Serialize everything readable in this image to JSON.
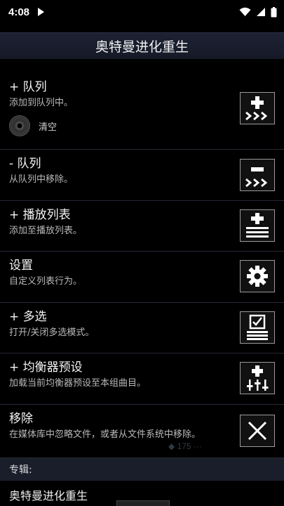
{
  "status": {
    "time": "4:08"
  },
  "header": {
    "title": "奥特曼进化重生"
  },
  "menu": [
    {
      "title": "+ 队列",
      "desc": "添加到队列中。",
      "icon": "add-to-queue-icon"
    },
    {
      "title": "- 队列",
      "desc": "从队列中移除。",
      "icon": "remove-from-queue-icon"
    },
    {
      "title": "+ 播放列表",
      "desc": "添加至播放列表。",
      "icon": "add-to-playlist-icon"
    },
    {
      "title": "设置",
      "desc": "自定义列表行为。",
      "icon": "gear-icon"
    },
    {
      "title": "+ 多选",
      "desc": "打开/关闭多选模式。",
      "icon": "multi-select-icon"
    },
    {
      "title": "+ 均衡器预设",
      "desc": "加载当前均衡器预设至本组曲目。",
      "icon": "equalizer-icon"
    },
    {
      "title": "移除",
      "desc": "在媒体库中忽略文件，或者从文件系统中移除。",
      "icon": "close-icon"
    }
  ],
  "queue_clear": {
    "label": "清空",
    "icon": "disc-icon"
  },
  "album": {
    "section_label": "专辑:",
    "name": "奥特曼进化重生"
  },
  "colors": {
    "background": "#000000",
    "header": "#1d2233",
    "button_border": "#9a9a9a"
  }
}
